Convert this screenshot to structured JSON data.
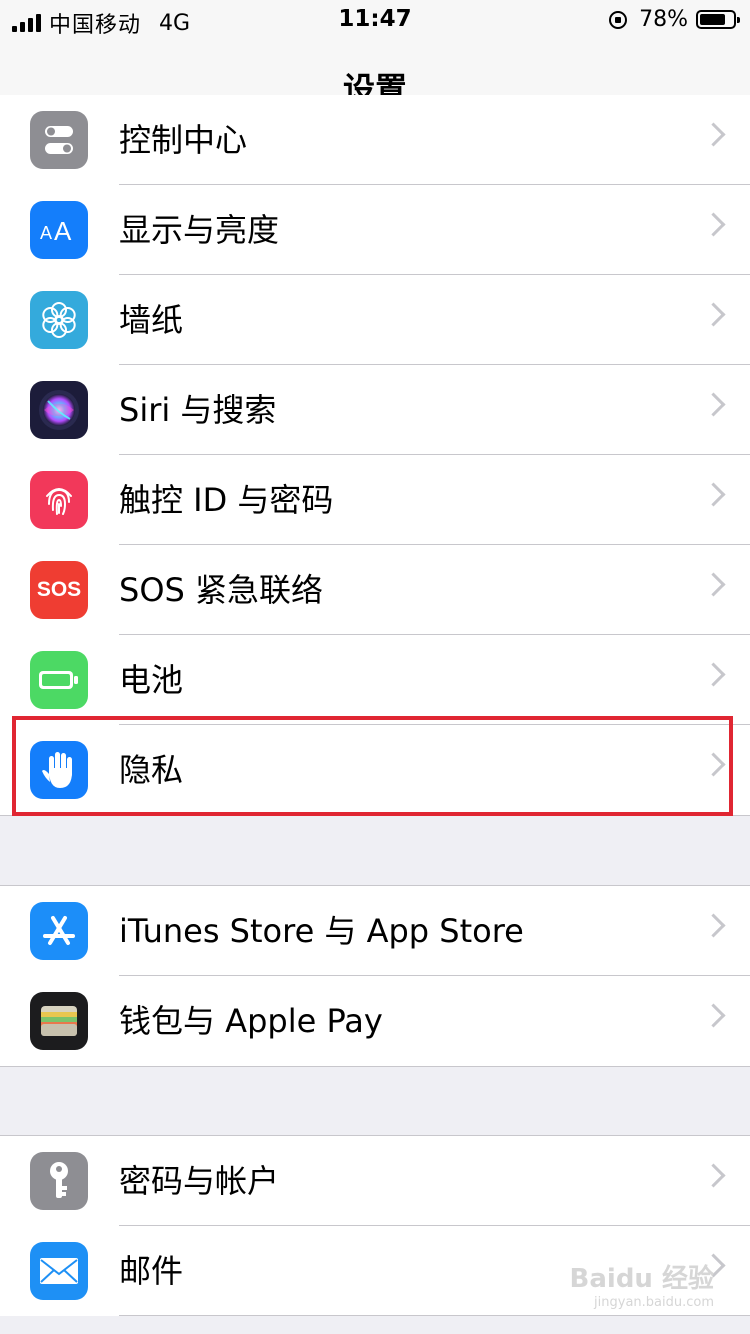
{
  "status_bar": {
    "carrier": "中国移动",
    "network": "4G",
    "time": "11:47",
    "battery_percent": "78%",
    "battery_level": 0.78
  },
  "nav": {
    "title": "设置"
  },
  "rows": [
    {
      "label": "控制中心",
      "icon": "control-center-icon",
      "color": "#8e8e93"
    },
    {
      "label": "显示与亮度",
      "icon": "display-brightness-icon",
      "color": "#147efb"
    },
    {
      "label": "墙纸",
      "icon": "wallpaper-flower-icon",
      "color": "#34aadc"
    },
    {
      "label": "Siri 与搜索",
      "icon": "siri-icon",
      "color": "#1c1c3a"
    },
    {
      "label": "触控 ID 与密码",
      "icon": "fingerprint-icon",
      "color": "#f2385a"
    },
    {
      "label": "SOS 紧急联络",
      "icon": "sos-icon",
      "color": "#ef3d32",
      "icon_text": "SOS"
    },
    {
      "label": "电池",
      "icon": "battery-icon",
      "color": "#4cd964"
    },
    {
      "label": "隐私",
      "icon": "privacy-hand-icon",
      "color": "#147efb"
    },
    {
      "label": "iTunes Store 与 App Store",
      "icon": "app-store-icon",
      "color": "#1c8ef9"
    },
    {
      "label": "钱包与 Apple Pay",
      "icon": "wallet-icon",
      "color": "#1c1c1e"
    },
    {
      "label": "密码与帐户",
      "icon": "key-icon",
      "color": "#8e8e93"
    },
    {
      "label": "邮件",
      "icon": "mail-icon",
      "color": "#1e90f5"
    }
  ],
  "highlight_color": "#e02632",
  "watermark": {
    "brand": "Baidu 经验",
    "url": "jingyan.baidu.com"
  }
}
